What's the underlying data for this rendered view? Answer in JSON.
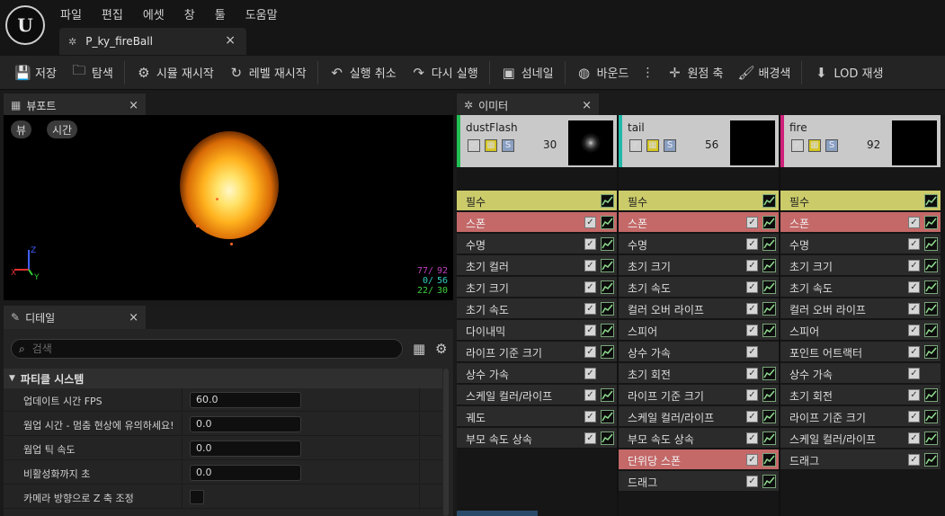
{
  "menu": [
    "파일",
    "편집",
    "에셋",
    "창",
    "툴",
    "도움말"
  ],
  "logo": "U",
  "document_tab": {
    "label": "P_ky_fireBall",
    "close": "×"
  },
  "toolbar": [
    {
      "icon": "save-icon",
      "glyph": "💾",
      "label": "저장"
    },
    {
      "icon": "browse-icon",
      "glyph": "🗀",
      "label": "탐색"
    },
    {
      "icon": "restart-sim-icon",
      "glyph": "⚙",
      "label": "시뮬 재시작"
    },
    {
      "icon": "restart-level-icon",
      "glyph": "↻",
      "label": "레벨 재시작"
    },
    {
      "icon": "undo-icon",
      "glyph": "↶",
      "label": "실행 취소"
    },
    {
      "icon": "redo-icon",
      "glyph": "↷",
      "label": "다시 실행"
    },
    {
      "icon": "thumbnail-icon",
      "glyph": "▣",
      "label": "섬네일"
    },
    {
      "icon": "bounds-icon",
      "glyph": "◍",
      "label": "바운드"
    },
    {
      "icon": "origin-axis-icon",
      "glyph": "✛",
      "label": "원점 축"
    },
    {
      "icon": "background-color-icon",
      "glyph": "🖌",
      "label": "배경색"
    },
    {
      "icon": "lod-icon",
      "glyph": "⬇",
      "label": "LOD 재생"
    }
  ],
  "viewport": {
    "tab_label": "뷰포트",
    "close": "×",
    "pill_view": "뷰",
    "pill_time": "시간",
    "stats": [
      {
        "a": "77/",
        "b": "92",
        "color": "#c040c0"
      },
      {
        "a": "0/",
        "b": "56",
        "color": "#30d0c0"
      },
      {
        "a": "22/",
        "b": "30",
        "color": "#40d040"
      }
    ],
    "axis_x": "X",
    "axis_y": "Y",
    "axis_z": "Z"
  },
  "details": {
    "tab_label": "디테일",
    "close": "×",
    "search_placeholder": "검색",
    "section": "파티클 시스템",
    "properties": [
      {
        "label": "업데이트 시간 FPS",
        "value": "60.0",
        "type": "number"
      },
      {
        "label": "웜업 시간 - 멈춤 현상에 유의하세요!",
        "value": "0.0",
        "type": "number"
      },
      {
        "label": "웜업 틱 속도",
        "value": "0.0",
        "type": "number"
      },
      {
        "label": "비활성화까지 초",
        "value": "0.0",
        "type": "number"
      },
      {
        "label": "카메라 방향으로 Z 축 조정",
        "value": "",
        "type": "checkbox"
      }
    ]
  },
  "emitters": {
    "tab_label": "이미터",
    "close": "×",
    "columns": [
      {
        "name": "dustFlash",
        "count": "30",
        "stripe": "#22c055",
        "thumb": "dust",
        "modules": [
          {
            "label": "필수",
            "kind": "req",
            "graph": true
          },
          {
            "label": "스폰",
            "kind": "spawn",
            "graph": true
          },
          {
            "label": "수명",
            "kind": "normal",
            "graph": true
          },
          {
            "label": "초기 컬러",
            "kind": "normal",
            "graph": true
          },
          {
            "label": "초기 크기",
            "kind": "normal",
            "graph": true
          },
          {
            "label": "초기 속도",
            "kind": "normal",
            "graph": true
          },
          {
            "label": "다이내믹",
            "kind": "normal",
            "graph": true
          },
          {
            "label": "라이프 기준 크기",
            "kind": "normal",
            "graph": true
          },
          {
            "label": "상수 가속",
            "kind": "normal",
            "graph": false
          },
          {
            "label": "스케일 컬러/라이프",
            "kind": "normal",
            "graph": true
          },
          {
            "label": "궤도",
            "kind": "normal",
            "graph": true
          },
          {
            "label": "부모 속도 상속",
            "kind": "normal",
            "graph": true
          }
        ]
      },
      {
        "name": "tail",
        "count": "56",
        "stripe": "#20b8a8",
        "thumb": "black",
        "modules": [
          {
            "label": "필수",
            "kind": "req",
            "graph": true
          },
          {
            "label": "스폰",
            "kind": "spawn",
            "graph": true
          },
          {
            "label": "수명",
            "kind": "normal",
            "graph": true
          },
          {
            "label": "초기 크기",
            "kind": "normal",
            "graph": true
          },
          {
            "label": "초기 속도",
            "kind": "normal",
            "graph": true
          },
          {
            "label": "컬러 오버 라이프",
            "kind": "normal",
            "graph": true
          },
          {
            "label": "스피어",
            "kind": "normal",
            "graph": true
          },
          {
            "label": "상수 가속",
            "kind": "normal",
            "graph": false
          },
          {
            "label": "초기 회전",
            "kind": "normal",
            "graph": true
          },
          {
            "label": "라이프 기준 크기",
            "kind": "normal",
            "graph": true
          },
          {
            "label": "스케일 컬러/라이프",
            "kind": "normal",
            "graph": true
          },
          {
            "label": "부모 속도 상속",
            "kind": "normal",
            "graph": true
          },
          {
            "label": "단위당 스폰",
            "kind": "spawn",
            "graph": true
          },
          {
            "label": "드래그",
            "kind": "normal",
            "graph": true
          }
        ]
      },
      {
        "name": "fire",
        "count": "92",
        "stripe": "#d0207a",
        "thumb": "black",
        "modules": [
          {
            "label": "필수",
            "kind": "req",
            "graph": true
          },
          {
            "label": "스폰",
            "kind": "spawn",
            "graph": true
          },
          {
            "label": "수명",
            "kind": "normal",
            "graph": true
          },
          {
            "label": "초기 크기",
            "kind": "normal",
            "graph": true
          },
          {
            "label": "초기 속도",
            "kind": "normal",
            "graph": true
          },
          {
            "label": "컬러 오버 라이프",
            "kind": "normal",
            "graph": true
          },
          {
            "label": "스피어",
            "kind": "normal",
            "graph": true
          },
          {
            "label": "포인트 어트랙터",
            "kind": "normal",
            "graph": true
          },
          {
            "label": "상수 가속",
            "kind": "normal",
            "graph": false
          },
          {
            "label": "초기 회전",
            "kind": "normal",
            "graph": true
          },
          {
            "label": "라이프 기준 크기",
            "kind": "normal",
            "graph": true
          },
          {
            "label": "스케일 컬러/라이프",
            "kind": "normal",
            "graph": true
          },
          {
            "label": "드래그",
            "kind": "normal",
            "graph": true
          }
        ]
      }
    ]
  }
}
